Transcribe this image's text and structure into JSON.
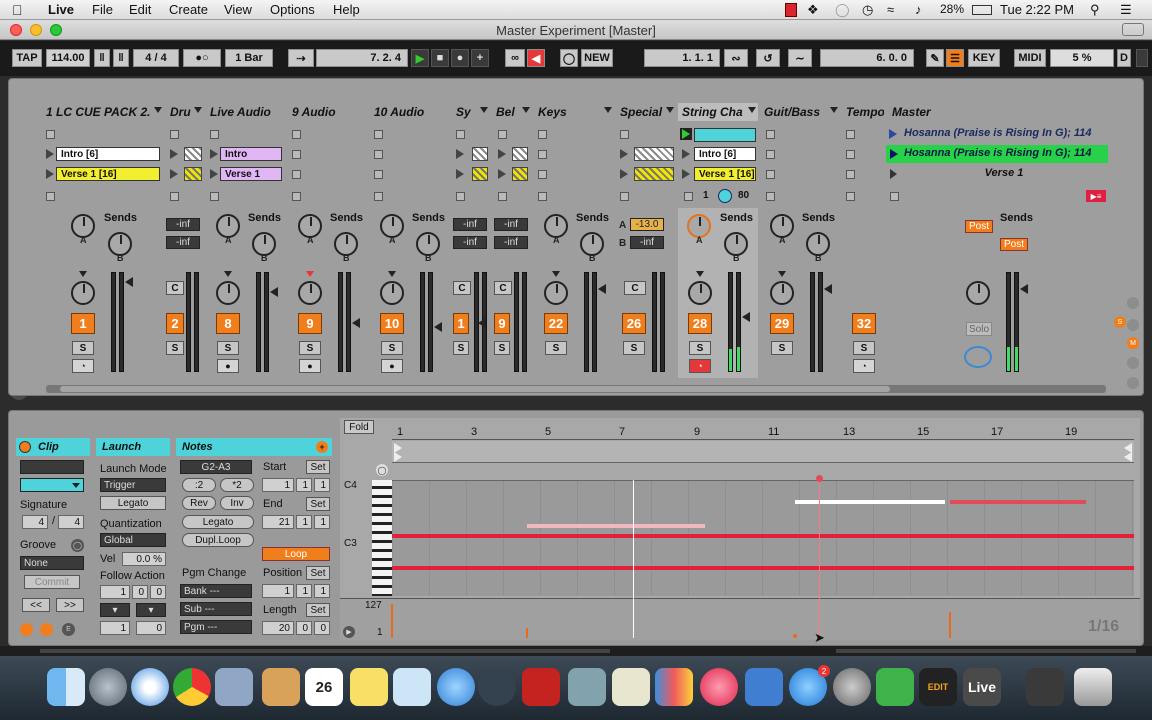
{
  "menubar": {
    "app": "Live",
    "items": [
      "File",
      "Edit",
      "Create",
      "View",
      "Options",
      "Help"
    ],
    "battery": "28%",
    "clock": "Tue 2:22 PM"
  },
  "window": {
    "title": "Master Experiment  [Master]"
  },
  "control_bar": {
    "tap": "TAP",
    "tempo": "114.00",
    "signature": "4 / 4",
    "quantize": "1 Bar",
    "position": "7.   2.   4",
    "new": "NEW",
    "loop_start": "1.   1.   1",
    "loop_length": "6.   0.   0",
    "key": "KEY",
    "midi": "MIDI",
    "cpu": "5 %",
    "d": "D"
  },
  "tracks": [
    {
      "name": "1 LC CUE PACK 2.",
      "clips": [
        "",
        "Intro [6]",
        "Verse 1 [16]"
      ],
      "number": "1"
    },
    {
      "name": "Dru",
      "number": "2"
    },
    {
      "name": "Live Audio",
      "clips": [
        "",
        "Intro",
        "Verse 1"
      ],
      "number": "8"
    },
    {
      "name": "9 Audio",
      "number": "9"
    },
    {
      "name": "10 Audio",
      "number": "10"
    },
    {
      "name": "Sy",
      "number": "1"
    },
    {
      "name": "Bel",
      "number": "9"
    },
    {
      "name": "Keys",
      "number": "22"
    },
    {
      "name": "Special",
      "number": "26"
    },
    {
      "name": "String Cha",
      "clips": [
        "",
        "Intro [6]",
        "Verse 1 [16]"
      ],
      "number": "28"
    },
    {
      "name": "Guit/Bass",
      "number": "29"
    },
    {
      "name": "Tempo",
      "number": "32"
    },
    {
      "name": "Master"
    }
  ],
  "master_scenes": [
    "Hosanna (Praise is Rising In G); 114",
    "Hosanna (Praise is Rising In G); 114",
    "Verse 1"
  ],
  "mixer": {
    "sends_label": "Sends",
    "neg_inf": "-inf",
    "special_a": "-13.0",
    "special_a_label": "A",
    "special_b_label": "B",
    "string_counter": "1",
    "string_counter_right": "80",
    "post": "Post",
    "solo_btn": "S",
    "c_btn": "C",
    "solo_master": "Solo"
  },
  "clip_panel": {
    "header": "Clip",
    "signature_label": "Signature",
    "sig_num": "4",
    "sig_sep": "/",
    "sig_den": "4",
    "groove_label": "Groove",
    "groove_value": "None",
    "commit": "Commit",
    "prev": "<<",
    "next": ">>"
  },
  "launch_panel": {
    "header": "Launch",
    "launch_mode_label": "Launch Mode",
    "launch_mode": "Trigger",
    "legato": "Legato",
    "quantization_label": "Quantization",
    "quantization": "Global",
    "vel_label": "Vel",
    "vel_value": "0.0 %",
    "follow_action_label": "Follow Action",
    "fa_a": "1",
    "fa_b": "0",
    "fa_c": "0",
    "fa_d": "1",
    "fa_e": "0"
  },
  "notes_panel": {
    "header": "Notes",
    "range": "G2-A3",
    "half": ":2",
    "double": "*2",
    "rev": "Rev",
    "inv": "Inv",
    "legato": "Legato",
    "dupl_loop": "Dupl.Loop",
    "pgm_change": "Pgm Change",
    "bank": "Bank ---",
    "sub": "Sub ---",
    "pgm": "Pgm ---",
    "start_label": "Start",
    "set": "Set",
    "start": [
      "1",
      "1",
      "1"
    ],
    "end_label": "End",
    "end": [
      "21",
      "1",
      "1"
    ],
    "loop": "Loop",
    "position_label": "Position",
    "position": [
      "1",
      "1",
      "1"
    ],
    "length_label": "Length",
    "length": [
      "20",
      "0",
      "0"
    ]
  },
  "piano_roll": {
    "fold": "Fold",
    "ruler": [
      "1",
      "3",
      "5",
      "7",
      "9",
      "11",
      "13",
      "15",
      "17",
      "19"
    ],
    "c4": "C4",
    "c3": "C3",
    "vel_max": "127",
    "vel_min": "1",
    "grid": "1/16"
  },
  "dock": {
    "calendar_day": "26",
    "live_label": "Live",
    "edit_label": "EDIT"
  }
}
